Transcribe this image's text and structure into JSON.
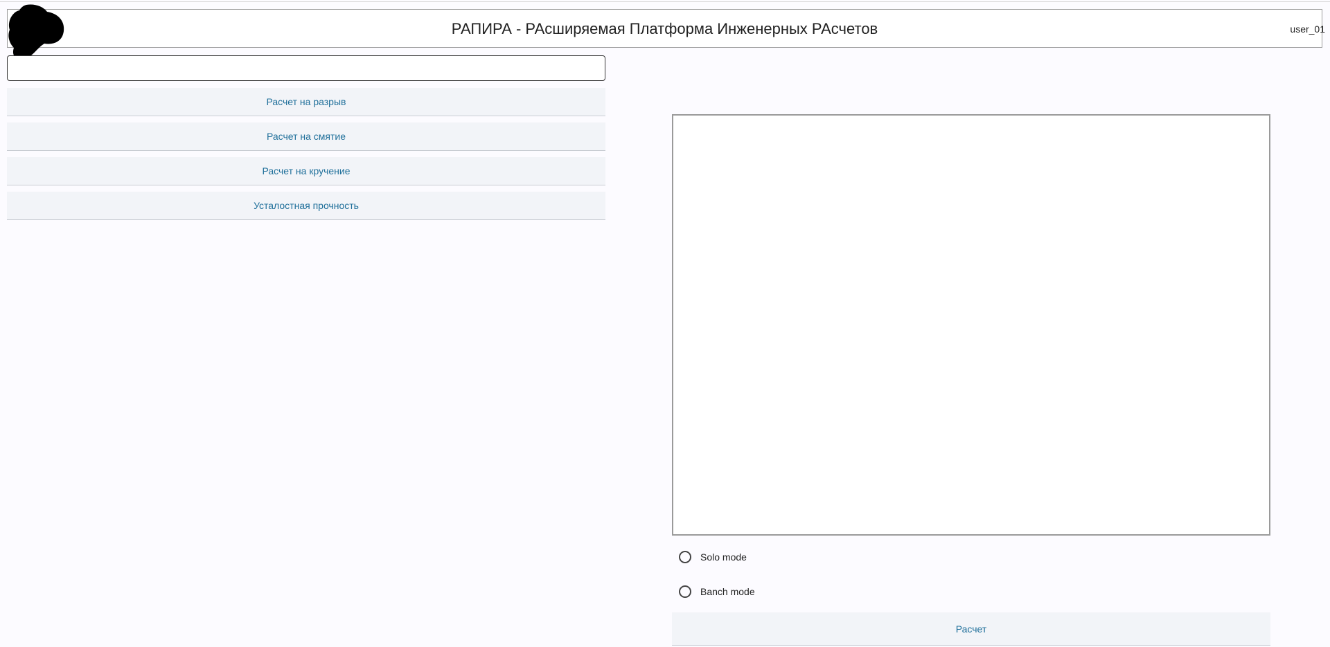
{
  "header": {
    "title": "РАПИРА - РАсширяемая Платформа Инженерных РАсчетов",
    "user": "user_01",
    "logo_icon": "logo-blob-icon"
  },
  "search": {
    "value": "",
    "placeholder": ""
  },
  "menu": {
    "items": [
      {
        "label": "Расчет на разрыв"
      },
      {
        "label": "Расчет на смятие"
      },
      {
        "label": "Расчет на кручение"
      },
      {
        "label": "Усталостная прочность"
      }
    ]
  },
  "modes": {
    "solo_label": "Solo mode",
    "banch_label": "Banch mode",
    "selected": ""
  },
  "actions": {
    "calc_label": "Расчет"
  },
  "colors": {
    "background": "#fcfbff",
    "accent_text": "#1f6f9a",
    "button_bg": "#f2f4f8"
  }
}
